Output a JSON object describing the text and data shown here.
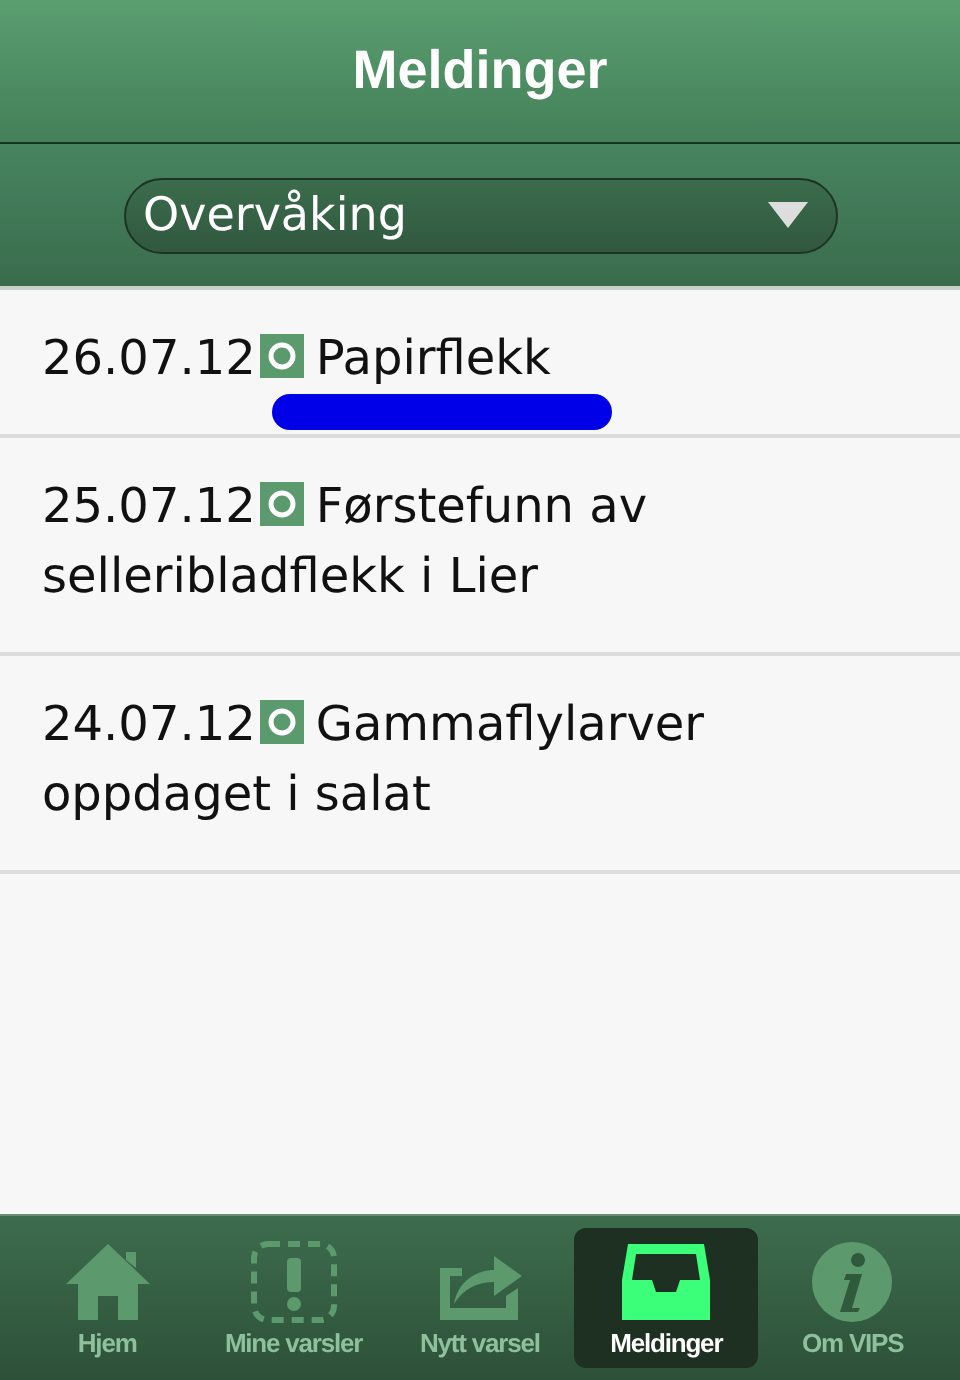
{
  "header": {
    "title": "Meldinger"
  },
  "filter": {
    "value": "Overvåking"
  },
  "messages": [
    {
      "date": "26.07.12",
      "title": "Papirflekk",
      "underlined": true
    },
    {
      "date": "25.07.12",
      "title": "Førstefunn av selleribladflekk i Lier",
      "underlined": false
    },
    {
      "date": "24.07.12",
      "title": "Gammaflylarver oppdaget i salat",
      "underlined": false
    }
  ],
  "tabs": [
    {
      "label": "Hjem",
      "kind": "home",
      "selected": false
    },
    {
      "label": "Mine varsler",
      "kind": "alerts",
      "selected": false
    },
    {
      "label": "Nytt varsel",
      "kind": "share",
      "selected": false
    },
    {
      "label": "Meldinger",
      "kind": "inbox",
      "selected": true
    },
    {
      "label": "Om VIPS",
      "kind": "info",
      "selected": false
    }
  ]
}
